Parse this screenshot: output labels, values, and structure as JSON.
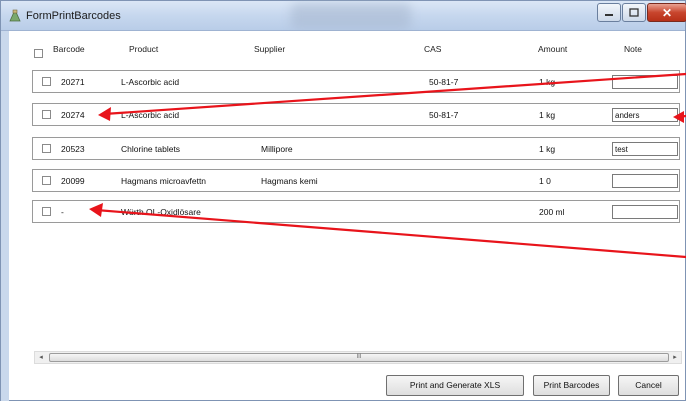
{
  "window": {
    "title": "FormPrintBarcodes",
    "title_bar_buttons": [
      "minimize",
      "maximize",
      "close"
    ]
  },
  "table": {
    "headers": {
      "barcode": "Barcode",
      "product": "Product",
      "supplier": "Supplier",
      "cas": "CAS",
      "amount": "Amount",
      "note": "Note"
    },
    "rows": [
      {
        "barcode": "20271",
        "product": "L-Ascorbic acid",
        "supplier": "",
        "cas": "50-81-7",
        "amount": "1 kg",
        "note": ""
      },
      {
        "barcode": "20274",
        "product": "L-Ascorbic acid",
        "supplier": "",
        "cas": "50-81-7",
        "amount": "1 kg",
        "note": "anders"
      },
      {
        "barcode": "20523",
        "product": "Chlorine tablets",
        "supplier": "Millipore",
        "cas": "",
        "amount": "1 kg",
        "note": "test"
      },
      {
        "barcode": "20099",
        "product": "Hagmans microavfettn",
        "supplier": "Hagmans kemi",
        "cas": "",
        "amount": "1 0",
        "note": ""
      },
      {
        "barcode": "-",
        "product": "Würth OL-Oxidlösare",
        "supplier": "",
        "cas": "",
        "amount": "200 ml",
        "note": ""
      }
    ]
  },
  "scrollbar": {
    "thumb_grip": "III",
    "left_arrow": "◂",
    "right_arrow": "▸"
  },
  "buttons": {
    "print_xls": "Print and Generate XLS",
    "print_barcodes": "Print Barcodes",
    "cancel": "Cancel"
  },
  "colors": {
    "annotation_arrow": "#e8141b",
    "title_bar": "#c6d7ee"
  },
  "icons": {
    "app": "app-icon",
    "annotation": "red-arrow-icon"
  }
}
